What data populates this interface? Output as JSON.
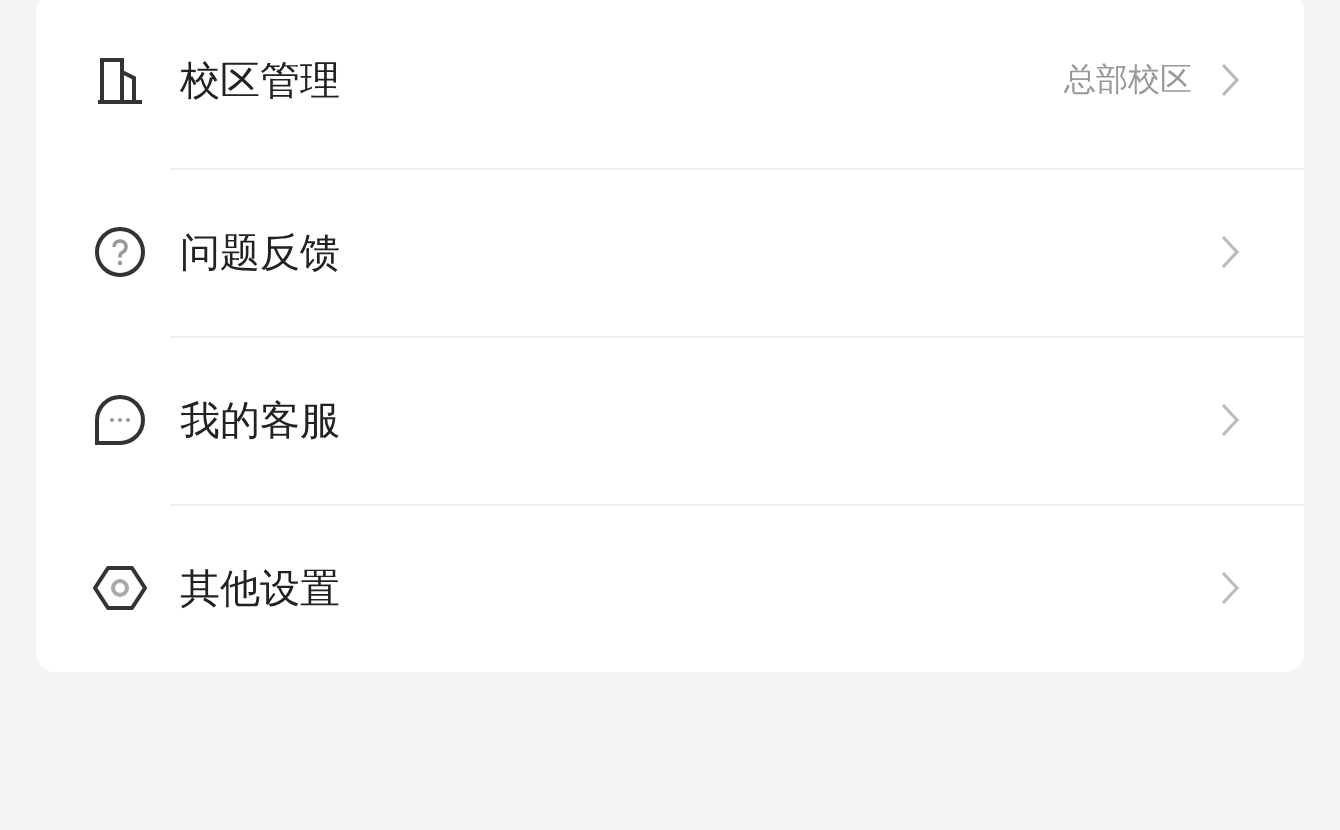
{
  "menu": [
    {
      "kind": "building",
      "label": "校区管理",
      "value": "总部校区"
    },
    {
      "kind": "question",
      "label": "问题反馈"
    },
    {
      "kind": "chat",
      "label": "我的客服"
    },
    {
      "kind": "hexagon",
      "label": "其他设置"
    }
  ]
}
